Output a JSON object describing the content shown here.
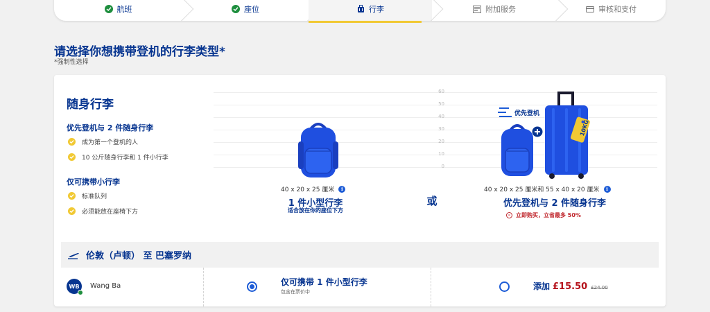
{
  "steps": [
    {
      "label": "航班",
      "status": "done",
      "icon": "check-circle-icon"
    },
    {
      "label": "座位",
      "status": "done",
      "icon": "check-circle-icon"
    },
    {
      "label": "行李",
      "status": "active",
      "icon": "luggage-icon"
    },
    {
      "label": "附加服务",
      "status": "inactive",
      "icon": "extras-icon"
    },
    {
      "label": "审核和支付",
      "status": "inactive",
      "icon": "card-icon"
    }
  ],
  "page": {
    "title": "请选择你想携带登机的行李类型*",
    "required_note": "*强制性选择"
  },
  "cabin": {
    "title": "随身行李",
    "groups": [
      {
        "title": "优先登机与 2 件随身行李",
        "bullets": [
          "成为第一个登机的人",
          "10 公斤随身行李和 1 件小行李"
        ]
      },
      {
        "title": "仅可携带小行李",
        "bullets": [
          "标准队列",
          "必须能放在座椅下方"
        ]
      }
    ],
    "scale_labels": [
      "60",
      "50",
      "40",
      "30",
      "20",
      "10",
      "0"
    ],
    "option_small": {
      "dims": "40 x 20 x 25 厘米",
      "name": "1 件小型行李",
      "sub": "适合放在你的座位下方"
    },
    "or_label": "或",
    "option_priority": {
      "tag": "优先登机",
      "bag_label": "10KG",
      "dims": "40 x 20 x 25 厘米和 55 x 40 x 20 厘米",
      "name": "优先登机与 2 件随身行李",
      "promo": "立即购买，立省最多 50%"
    }
  },
  "route": {
    "label": "伦敦（卢顿） 至 巴塞罗纳"
  },
  "passenger": {
    "initials": "WB",
    "name": "Wang Ba",
    "opt1_title": "仅可携带 1 件小型行李",
    "opt1_sub": "包含在票价中",
    "opt1_selected": true,
    "opt2_add": "添加",
    "opt2_price": "£15.50",
    "opt2_old_price": "£24.00",
    "opt2_selected": false
  },
  "colors": {
    "brand": "#073590",
    "accent": "#f1c933",
    "price": "#b5121b",
    "success": "#1e8e3e"
  }
}
